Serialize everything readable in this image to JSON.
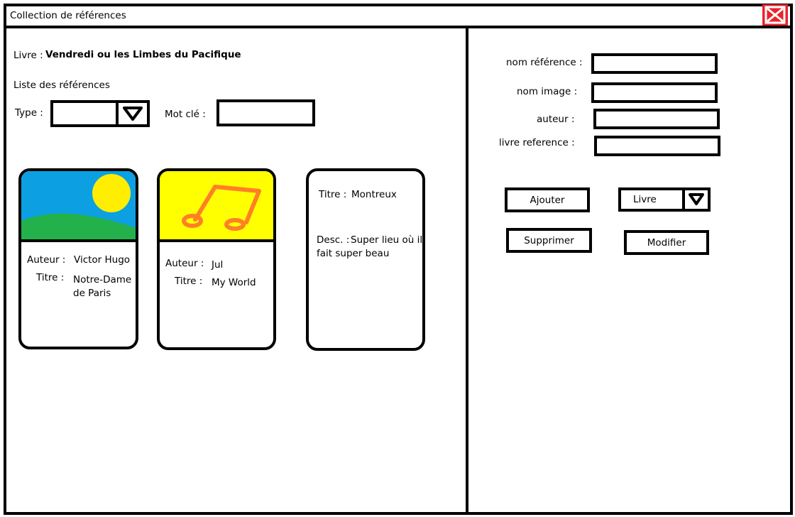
{
  "window": {
    "title": "Collection de références"
  },
  "left": {
    "book_label": "Livre :",
    "book_value": "Vendredi ou les Limbes du Pacifique",
    "list_heading": "Liste des références",
    "type_label": "Type :",
    "type_value": "",
    "keyword_label": "Mot clé :",
    "keyword_value": ""
  },
  "cards": [
    {
      "author_label": "Auteur :",
      "author": "Victor Hugo",
      "title_label": "Titre :",
      "title_line1": "Notre-Dame",
      "title_line2": "de Paris"
    },
    {
      "author_label": "Auteur :",
      "author": "Jul",
      "title_label": "Titre :",
      "title": "My World"
    },
    {
      "title_label": "Titre :",
      "title": "Montreux",
      "desc_label": "Desc. :",
      "desc_line1": "Super lieu où il",
      "desc_line2": "fait super beau"
    }
  ],
  "form": {
    "nom_reference_label": "nom référence :",
    "nom_image_label": "nom image :",
    "auteur_label": "auteur :",
    "livre_reference_label": "livre reference :",
    "add_label": "Ajouter",
    "type_select_value": "Livre",
    "delete_label": "Supprimer",
    "modify_label": "Modifier"
  },
  "colors": {
    "close_bg": "#e8242b",
    "sky": "#0ca0e2",
    "sun": "#ffee00",
    "grass": "#23b14c",
    "music_bg": "#ffff00",
    "music_stroke": "#ff7f27"
  }
}
